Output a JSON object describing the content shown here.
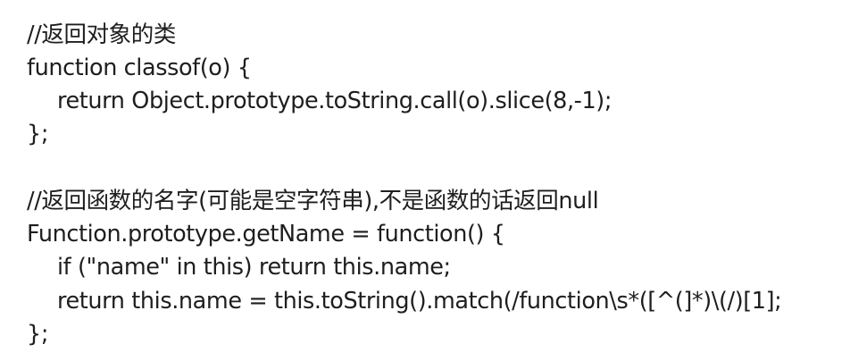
{
  "code_block": {
    "lines": [
      "//返回对象的类",
      "function classof(o) {",
      "return Object.prototype.toString.call(o).slice(8,-1);",
      "};",
      "//返回函数的名字(可能是空字符串),不是函数的话返回null",
      "Function.prototype.getName = function() {",
      "if (\"name\" in this) return this.name;",
      "return this.name = this.toString().match(/function\\s*([^(]*)\\(/)[1];",
      "};"
    ]
  }
}
